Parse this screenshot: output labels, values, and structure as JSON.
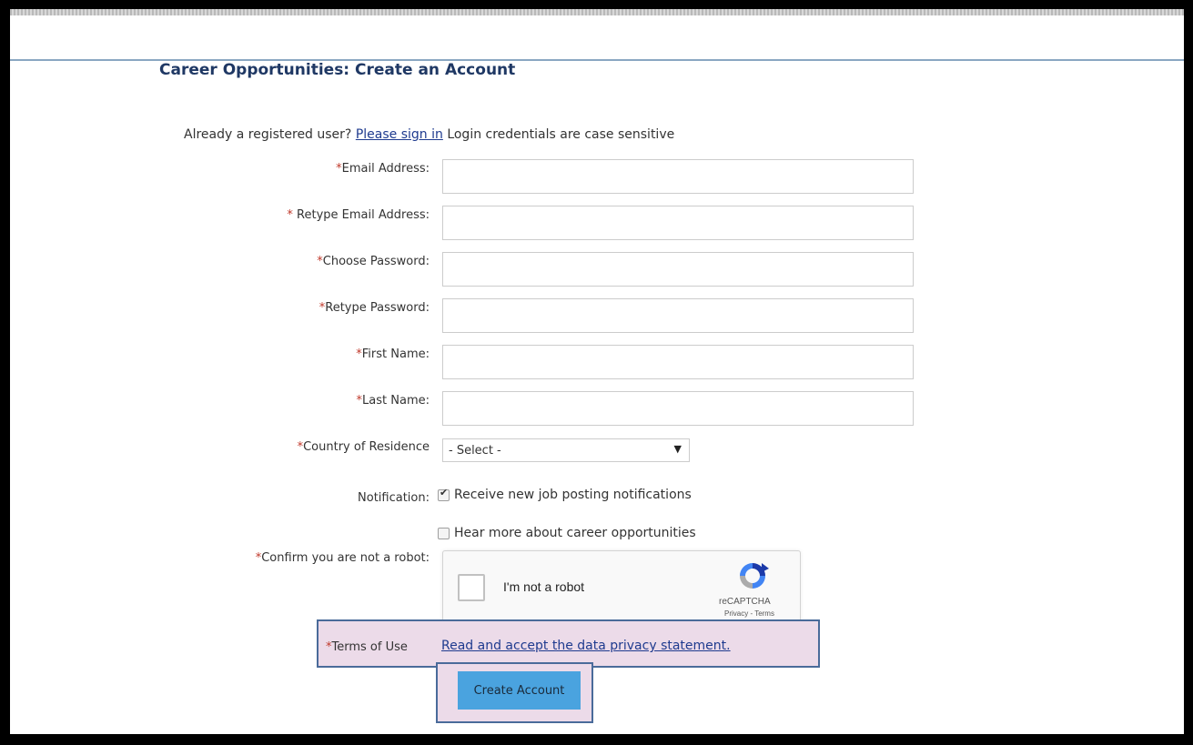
{
  "page": {
    "title": "Career Opportunities: Create an Account"
  },
  "signin": {
    "prefix": "Already a registered user?",
    "link_label": "Please sign in",
    "suffix": "Login credentials are case sensitive"
  },
  "form": {
    "required_marker": "*",
    "fields": {
      "email": {
        "label": "Email Address:",
        "value": ""
      },
      "retype_email": {
        "label": " Retype Email Address:",
        "value": ""
      },
      "password": {
        "label": "Choose Password:",
        "value": ""
      },
      "retype_password": {
        "label": "Retype Password:",
        "value": ""
      },
      "first_name": {
        "label": "First Name:",
        "value": ""
      },
      "last_name": {
        "label": "Last Name:",
        "value": ""
      }
    },
    "country": {
      "label": "Country of Residence",
      "selected": "- Select -"
    },
    "notification": {
      "label": "Notification:",
      "options": [
        {
          "label": "Receive new job posting notifications",
          "checked": true
        },
        {
          "label": "Hear more about career opportunities",
          "checked": false
        }
      ]
    },
    "robot": {
      "label": "Confirm you are not a robot:",
      "checkbox_label": "I'm not a robot",
      "brand": "reCAPTCHA",
      "links": "Privacy - Terms"
    },
    "terms": {
      "label": "Terms of Use",
      "link_label": "Read and accept the data privacy statement."
    },
    "submit_label": "Create Account"
  },
  "colors": {
    "title": "#1f3864",
    "required": "#c0392b",
    "link": "#1f3b8f",
    "button": "#4aa3df",
    "highlight_fill": "#ecdbe9",
    "highlight_border": "#4a6b9a"
  }
}
